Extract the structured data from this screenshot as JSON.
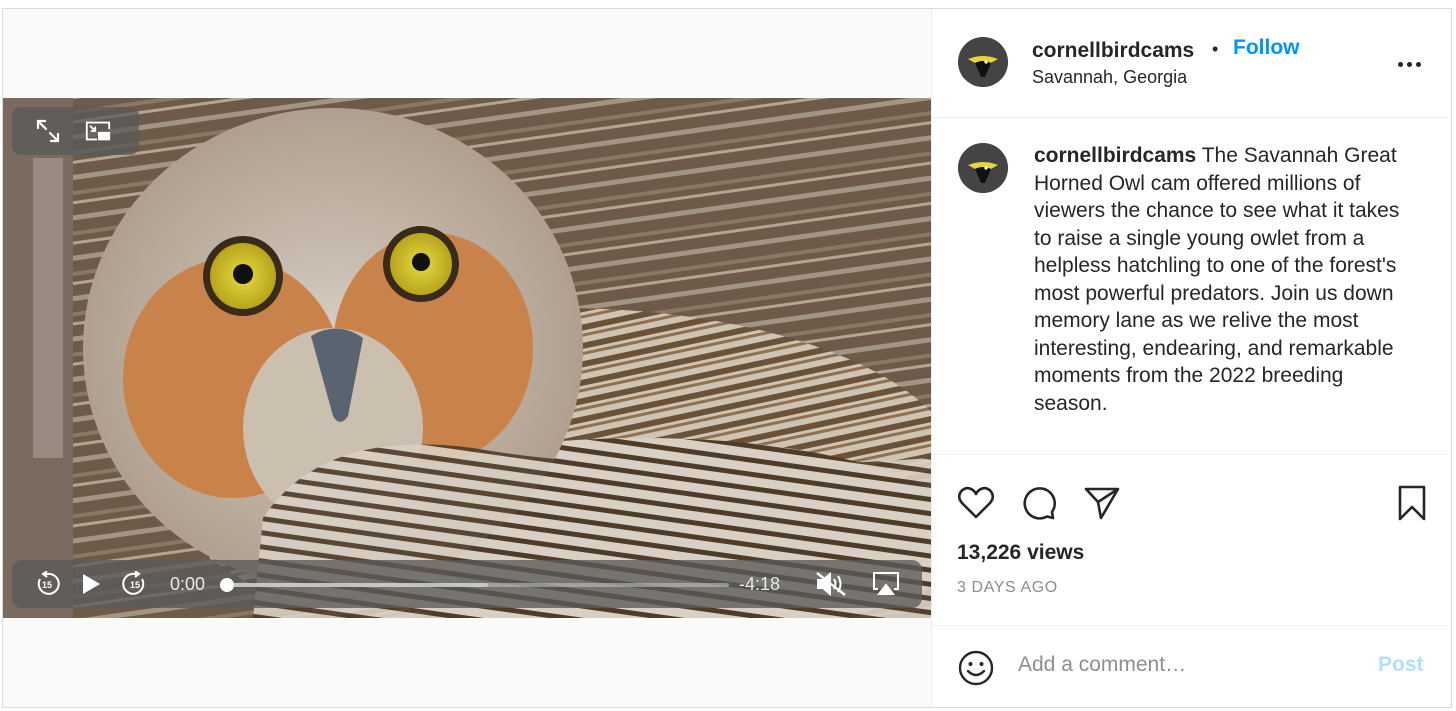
{
  "post": {
    "account": {
      "username": "cornellbirdcams",
      "location": "Savannah, Georgia",
      "follow_label": "Follow",
      "separator": "•"
    },
    "caption": {
      "username": "cornellbirdcams",
      "text": "The Savannah Great Horned Owl cam offered millions of viewers the chance to see what it takes to raise a single young owlet from a helpless hatchling to one of the forest's most powerful predators. Join us down memory lane as we relive the most interesting, endearing, and remarkable moments from the 2022 breeding season."
    },
    "video": {
      "current_time": "0:00",
      "remaining_time": "-4:18",
      "progress_fraction": 0.0,
      "buffered_fraction": 0.52,
      "icons": [
        "fullscreen-icon",
        "picture-in-picture-icon",
        "skip-back-15-icon",
        "play-icon",
        "skip-forward-15-icon",
        "muted-speaker-icon",
        "airplay-icon"
      ]
    },
    "stats": {
      "views": "13,226 views",
      "posted": "3 DAYS AGO"
    },
    "comment": {
      "placeholder": "Add a comment…",
      "post_label": "Post"
    },
    "icons": {
      "more": "more-options-icon",
      "like": "heart-icon",
      "comment": "comment-bubble-icon",
      "share": "share-paper-plane-icon",
      "save": "bookmark-icon",
      "emoji": "emoji-smiley-icon"
    },
    "colors": {
      "link_blue": "#0095f6",
      "post_disabled": "#b2dffc",
      "secondary_text": "#8e8e8e",
      "divider": "#efefef"
    }
  }
}
